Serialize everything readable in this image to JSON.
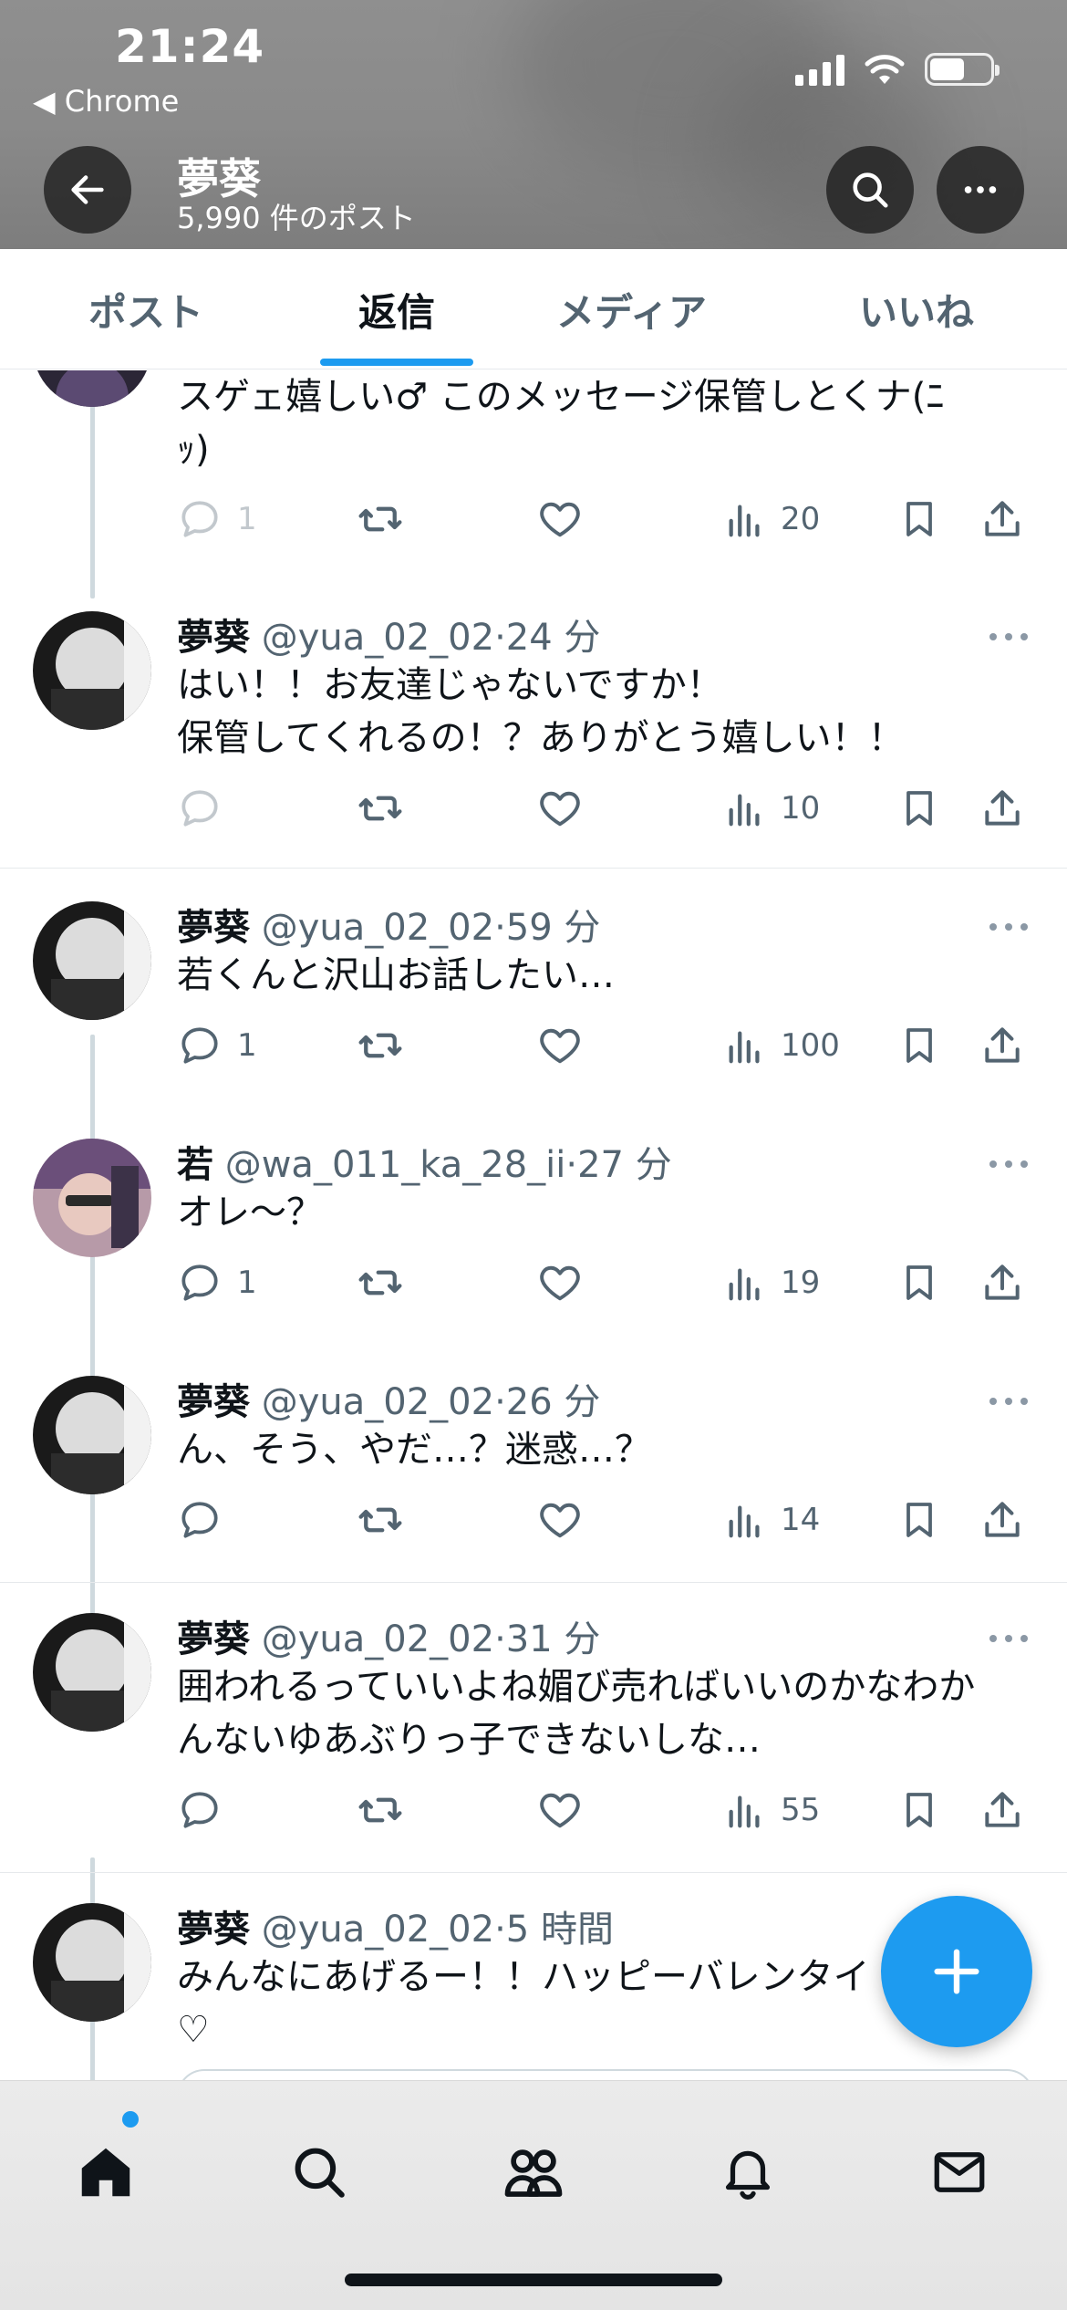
{
  "status_bar": {
    "time": "21:24",
    "back_app": "Chrome"
  },
  "profile": {
    "name": "夢葵",
    "post_count": "5,990 件のポスト"
  },
  "tabs": [
    {
      "label": "ポスト",
      "active": false
    },
    {
      "label": "返信",
      "active": true
    },
    {
      "label": "メディア",
      "active": false
    },
    {
      "label": "いいね",
      "active": false
    }
  ],
  "posts": [
    {
      "text_lines": [
        "スゲェ嬉しい♂ このメッセージ保管しとくナ(ﾆ",
        "ｯ)"
      ],
      "replies": "1",
      "views": "20"
    },
    {
      "name": "夢葵",
      "handle": "@yua_02_02",
      "time": "24 分",
      "text_lines": [
        "はい！！お友達じゃないですか！",
        "保管してくれるの！？ありがとう嬉しい！！"
      ],
      "replies": "",
      "views": "10"
    },
    {
      "name": "夢葵",
      "handle": "@yua_02_02",
      "time": "59 分",
      "text_lines": [
        "若くんと沢山お話したい…"
      ],
      "replies": "1",
      "views": "100"
    },
    {
      "name": "若",
      "handle": "@wa_011_ka_28_ii",
      "time": "27 分",
      "text_lines": [
        "オレ〜？"
      ],
      "replies": "1",
      "views": "19"
    },
    {
      "name": "夢葵",
      "handle": "@yua_02_02",
      "time": "26 分",
      "text_lines": [
        "ん、そう、やだ…？迷惑…？"
      ],
      "replies": "",
      "views": "14"
    },
    {
      "name": "夢葵",
      "handle": "@yua_02_02",
      "time": "31 分",
      "text_lines": [
        "囲われるっていいよね媚び売ればいいのかなわか",
        "んないゆあぶりっ子できないしな…"
      ],
      "replies": "",
      "views": "55"
    },
    {
      "name": "夢葵",
      "handle": "@yua_02_02",
      "time": "5 時間",
      "text_lines": [
        "みんなにあげるー！！ハッピーバレンタイ",
        "♡"
      ]
    }
  ],
  "separator": "·",
  "icons": {
    "back": "arrow-left-icon",
    "search": "search-icon",
    "more": "more-horizontal-icon",
    "reply": "reply-icon",
    "repost": "repost-icon",
    "like": "heart-icon",
    "views": "views-icon",
    "bookmark": "bookmark-icon",
    "share": "share-icon",
    "compose": "plus-icon",
    "home": "home-icon",
    "explore": "search-icon",
    "communities": "people-icon",
    "notifications": "bell-icon",
    "messages": "mail-icon"
  },
  "colors": {
    "accent": "#1d9bf0",
    "text": "#0f1419",
    "muted": "#536471",
    "header_bg": "#8a8a8a"
  }
}
